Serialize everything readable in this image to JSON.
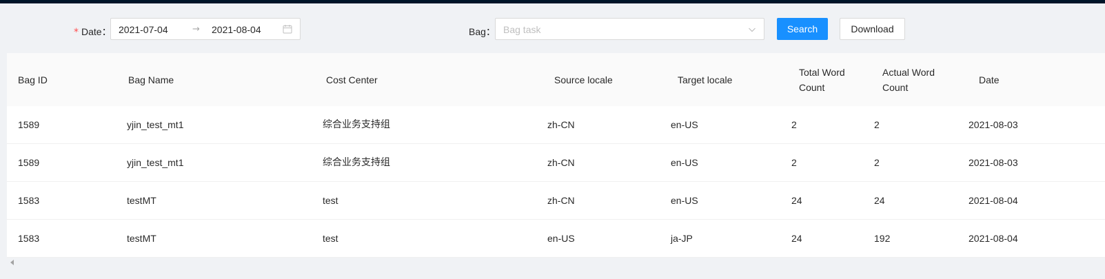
{
  "filters": {
    "date_label": "Date：",
    "date_required_mark": "*",
    "date_start": "2021-07-04",
    "date_end": "2021-08-04",
    "date_separator": "→",
    "bag_label": "Bag：",
    "bag_placeholder": "Bag task",
    "search_label": "Search",
    "download_label": "Download"
  },
  "table": {
    "columns": [
      {
        "id": "bag_id",
        "line1": "Bag ID",
        "line2": ""
      },
      {
        "id": "bag_name",
        "line1": "Bag Name",
        "line2": ""
      },
      {
        "id": "cost_center",
        "line1": "Cost Center",
        "line2": ""
      },
      {
        "id": "source_locale",
        "line1": "Source locale",
        "line2": ""
      },
      {
        "id": "target_locale",
        "line1": "Target locale",
        "line2": ""
      },
      {
        "id": "total_word_count",
        "line1": "Total Word",
        "line2": "Count"
      },
      {
        "id": "actual_word_count",
        "line1": "Actual Word",
        "line2": "Count"
      },
      {
        "id": "date",
        "line1": "Date",
        "line2": ""
      }
    ],
    "rows": [
      {
        "bag_id": "1589",
        "bag_name": "yjin_test_mt1",
        "cost_center": "综合业务支持组",
        "source_locale": "zh-CN",
        "target_locale": "en-US",
        "total_word_count": "2",
        "actual_word_count": "2",
        "date": "2021-08-03"
      },
      {
        "bag_id": "1589",
        "bag_name": "yjin_test_mt1",
        "cost_center": "综合业务支持组",
        "source_locale": "zh-CN",
        "target_locale": "en-US",
        "total_word_count": "2",
        "actual_word_count": "2",
        "date": "2021-08-03"
      },
      {
        "bag_id": "1583",
        "bag_name": "testMT",
        "cost_center": "test",
        "source_locale": "zh-CN",
        "target_locale": "en-US",
        "total_word_count": "24",
        "actual_word_count": "24",
        "date": "2021-08-04"
      },
      {
        "bag_id": "1583",
        "bag_name": "testMT",
        "cost_center": "test",
        "source_locale": "en-US",
        "target_locale": "ja-JP",
        "total_word_count": "24",
        "actual_word_count": "192",
        "date": "2021-08-04"
      }
    ]
  },
  "colors": {
    "primary": "#1890ff",
    "required": "#ff4d4f",
    "header_bar": "#001529",
    "page_bg": "#f0f2f5"
  }
}
